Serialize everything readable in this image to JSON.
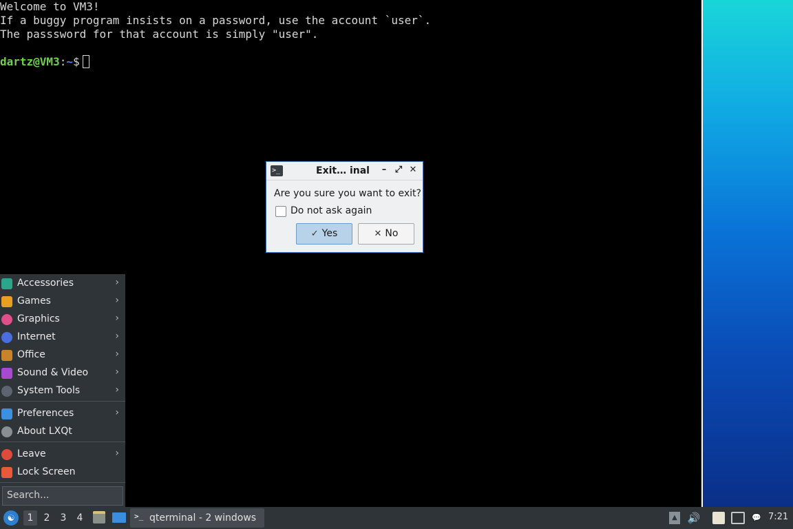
{
  "terminal": {
    "lines": [
      "Welcome to VM3!",
      "If a buggy program insists on a password, use the account `user`.",
      "The passsword for that account is simply \"user\".",
      ""
    ],
    "prompt_user": "dartz@VM3",
    "prompt_sep": ":",
    "prompt_path": "~",
    "prompt_end": "$"
  },
  "dialog": {
    "title": "Exit… inal",
    "minimize": "–",
    "maximize": "⤢",
    "close": "✕",
    "message": "Are you sure you want to exit?",
    "checkbox_label": "Do not ask again",
    "yes_label": "Yes",
    "no_label": "No",
    "yes_glyph": "✓",
    "no_glyph": "✕"
  },
  "menu": {
    "items": [
      {
        "label": "Accessories",
        "icon": "accessories-icon",
        "color": "#2ca58d",
        "arrow": "›"
      },
      {
        "label": "Games",
        "icon": "games-icon",
        "color": "#e8a020",
        "arrow": "›"
      },
      {
        "label": "Graphics",
        "icon": "graphics-icon",
        "color": "#e04f8a",
        "arrow": "›"
      },
      {
        "label": "Internet",
        "icon": "internet-icon",
        "color": "#4a6ee0",
        "arrow": "›"
      },
      {
        "label": "Office",
        "icon": "office-icon",
        "color": "#c8842a",
        "arrow": "›"
      },
      {
        "label": "Sound & Video",
        "icon": "sound-video-icon",
        "color": "#a64bd0",
        "arrow": "›"
      },
      {
        "label": "System Tools",
        "icon": "system-tools-icon",
        "color": "#5b6470",
        "arrow": "›"
      },
      {
        "label": "Preferences",
        "icon": "preferences-icon",
        "color": "#3f8fe0",
        "arrow": "›"
      },
      {
        "label": "About LXQt",
        "icon": "info-icon",
        "color": "#8a8f94",
        "arrow": ""
      },
      {
        "label": "Leave",
        "icon": "power-icon",
        "color": "#e04a3a",
        "arrow": "›"
      },
      {
        "label": "Lock Screen",
        "icon": "lock-icon",
        "color": "#e85a3a",
        "arrow": ""
      }
    ],
    "search_placeholder": "Search..."
  },
  "taskbar": {
    "workspaces": [
      "1",
      "2",
      "3",
      "4"
    ],
    "task_label": "qterminal - 2 windows",
    "clock": "7:21"
  },
  "colors": {
    "prompt_user": "#6fd04e",
    "prompt_path": "#5a7ee8",
    "dialog_border": "#3b74b8",
    "panel": "#2f3439"
  }
}
